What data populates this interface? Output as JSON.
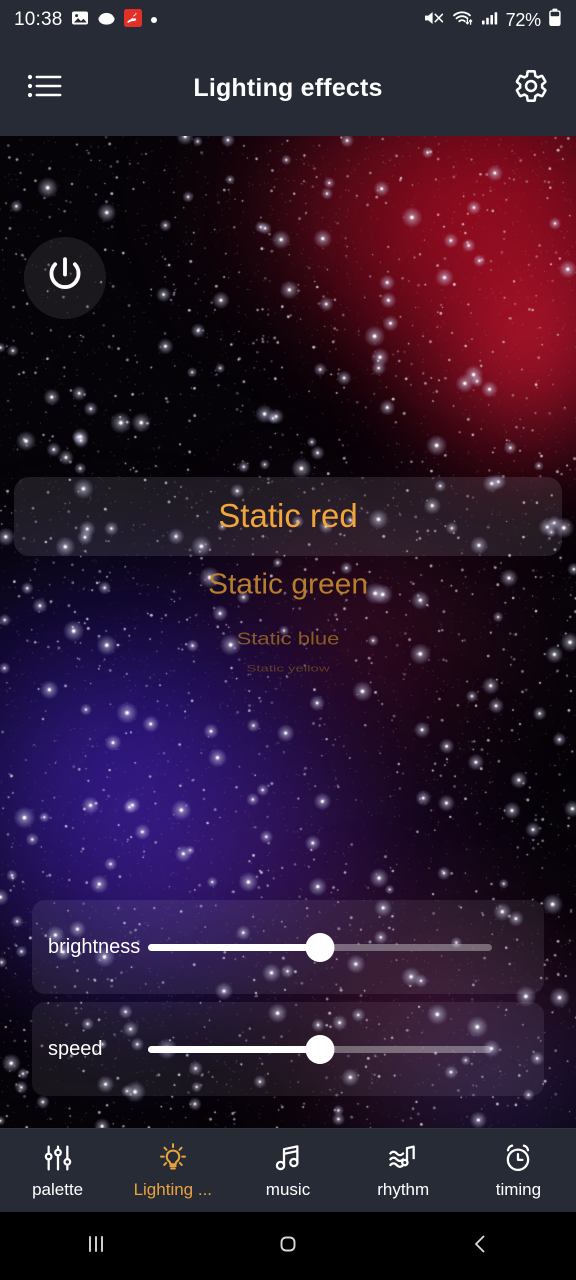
{
  "statusbar": {
    "time": "10:38",
    "battery_text": "72%",
    "left_icons": [
      "photo-icon",
      "disc-icon",
      "red-app-icon",
      "dot-icon"
    ],
    "right_icons": [
      "mute-icon",
      "wifi-icon",
      "signal-icon",
      "battery-icon"
    ]
  },
  "header": {
    "title": "Lighting effects",
    "menu_icon": "list-menu-icon",
    "settings_icon": "gear-icon"
  },
  "stage": {
    "power_button": "power-icon",
    "accent_color": "#e8a33d",
    "background_colors": [
      "#060308",
      "#be1026",
      "#381ea0",
      "#7a1a5a"
    ]
  },
  "effects": {
    "selected_index": 0,
    "items": [
      {
        "label": "Static red"
      },
      {
        "label": "Static green"
      },
      {
        "label": "Static blue"
      },
      {
        "label": "Static yellow"
      }
    ]
  },
  "sliders": [
    {
      "name": "brightness",
      "label": "brightness",
      "value": 50
    },
    {
      "name": "speed",
      "label": "speed",
      "value": 50
    }
  ],
  "bottom_nav": {
    "active_index": 1,
    "items": [
      {
        "label": "palette",
        "icon": "equalizer-sliders-icon"
      },
      {
        "label": "Lighting ...",
        "icon": "lightbulb-icon"
      },
      {
        "label": "music",
        "icon": "music-note-icon"
      },
      {
        "label": "rhythm",
        "icon": "wave-note-icon"
      },
      {
        "label": "timing",
        "icon": "alarm-clock-icon"
      }
    ]
  },
  "android_nav": {
    "items": [
      {
        "name": "recents",
        "icon": "recents-icon"
      },
      {
        "name": "home",
        "icon": "home-icon"
      },
      {
        "name": "back",
        "icon": "back-icon"
      }
    ]
  }
}
